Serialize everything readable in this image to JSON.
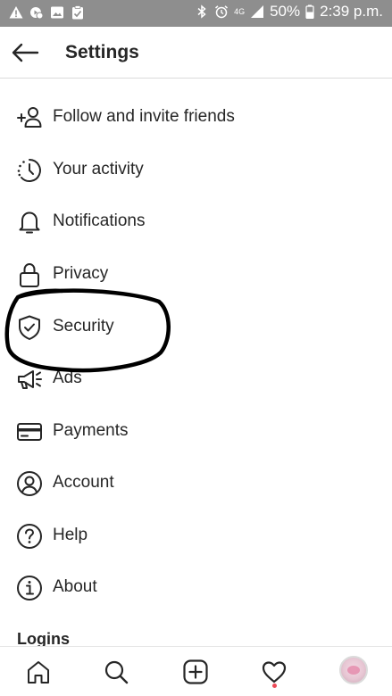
{
  "status_bar": {
    "battery": "50%",
    "time": "2:39 p.m.",
    "network": "4G",
    "left_icons": [
      "warning-icon",
      "media-icon",
      "image-icon",
      "clipboard-icon"
    ],
    "right_icons": [
      "bluetooth-icon",
      "alarm-icon",
      "signal-icon",
      "battery-icon"
    ]
  },
  "header": {
    "title": "Settings",
    "back_icon": "back-arrow-icon"
  },
  "settings": {
    "items": [
      {
        "label": "Follow and invite friends",
        "icon": "add-person-icon"
      },
      {
        "label": "Your activity",
        "icon": "activity-clock-icon"
      },
      {
        "label": "Notifications",
        "icon": "bell-icon"
      },
      {
        "label": "Privacy",
        "icon": "lock-icon"
      },
      {
        "label": "Security",
        "icon": "shield-icon",
        "highlighted": true
      },
      {
        "label": "Ads",
        "icon": "megaphone-icon"
      },
      {
        "label": "Payments",
        "icon": "card-icon"
      },
      {
        "label": "Account",
        "icon": "account-icon"
      },
      {
        "label": "Help",
        "icon": "help-icon"
      },
      {
        "label": "About",
        "icon": "info-icon"
      }
    ],
    "section_heading": "Logins"
  },
  "bottom_nav": {
    "items": [
      "home-icon",
      "search-icon",
      "new-post-icon",
      "activity-heart-icon",
      "profile-avatar"
    ],
    "activity_dot_color": "#ed4956"
  },
  "colors": {
    "status_bar": "#8e8e8e",
    "text": "#262626",
    "annotation": "#000000"
  }
}
